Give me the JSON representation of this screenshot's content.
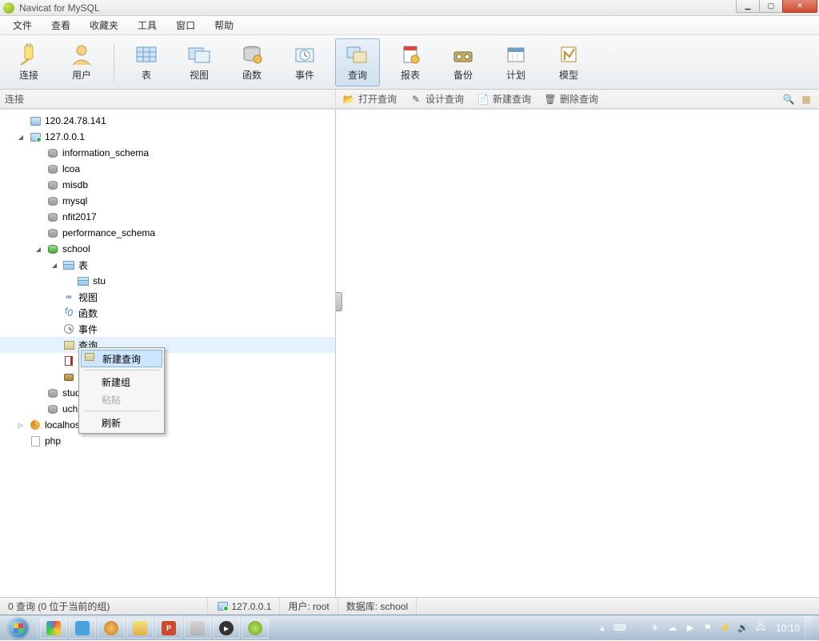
{
  "window": {
    "title": "Navicat for MySQL"
  },
  "menu": {
    "items": [
      "文件",
      "查看",
      "收藏夹",
      "工具",
      "窗口",
      "帮助"
    ]
  },
  "toolbar": {
    "groups": [
      {
        "items": [
          {
            "name": "connect",
            "label": "连接"
          },
          {
            "name": "user",
            "label": "用户"
          }
        ]
      },
      {
        "items": [
          {
            "name": "table",
            "label": "表"
          },
          {
            "name": "view",
            "label": "视图"
          },
          {
            "name": "function",
            "label": "函数"
          },
          {
            "name": "event",
            "label": "事件"
          },
          {
            "name": "query",
            "label": "查询",
            "active": true
          },
          {
            "name": "report",
            "label": "报表"
          },
          {
            "name": "backup",
            "label": "备份"
          },
          {
            "name": "schedule",
            "label": "计划"
          },
          {
            "name": "model",
            "label": "模型"
          }
        ]
      }
    ]
  },
  "sub_header": {
    "left_title": "连接",
    "actions": [
      {
        "name": "open-query",
        "label": "打开查询"
      },
      {
        "name": "design-query",
        "label": "设计查询"
      },
      {
        "name": "new-query",
        "label": "新建查询"
      },
      {
        "name": "delete-query",
        "label": "删除查询"
      }
    ]
  },
  "tree": {
    "nodes": [
      {
        "icon": "server",
        "label": "120.24.78.141",
        "depth": 1
      },
      {
        "icon": "server-on",
        "label": "127.0.0.1",
        "depth": 1,
        "arrow": "open"
      },
      {
        "icon": "db",
        "label": "information_schema",
        "depth": 2
      },
      {
        "icon": "db",
        "label": "lcoa",
        "depth": 2
      },
      {
        "icon": "db",
        "label": "misdb",
        "depth": 2
      },
      {
        "icon": "db",
        "label": "mysql",
        "depth": 2
      },
      {
        "icon": "db",
        "label": "nfit2017",
        "depth": 2
      },
      {
        "icon": "db",
        "label": "performance_schema",
        "depth": 2
      },
      {
        "icon": "db-active",
        "label": "school",
        "depth": 2,
        "arrow": "open"
      },
      {
        "icon": "folder-table",
        "label": "表",
        "depth": 3,
        "arrow": "open"
      },
      {
        "icon": "table",
        "label": "stu",
        "depth": 4
      },
      {
        "icon": "view",
        "label": "视图",
        "depth": 3
      },
      {
        "icon": "fn",
        "label": "函数",
        "depth": 3
      },
      {
        "icon": "event",
        "label": "事件",
        "depth": 3
      },
      {
        "icon": "query",
        "label": "查询",
        "depth": 3,
        "selected": true
      },
      {
        "icon": "report",
        "label": "报",
        "depth": 3
      },
      {
        "icon": "backup",
        "label": "备",
        "depth": 3
      },
      {
        "icon": "db",
        "label": "stude",
        "depth": 2
      },
      {
        "icon": "db",
        "label": "uchr_",
        "depth": 2
      },
      {
        "icon": "localhost",
        "label": "localhost",
        "depth": 1,
        "arrow": "closed"
      },
      {
        "icon": "file",
        "label": "php",
        "depth": 1
      }
    ]
  },
  "context_menu": {
    "items": [
      {
        "name": "new-query",
        "label": "新建查询",
        "highlight": true,
        "icon": true
      },
      {
        "sep": true
      },
      {
        "name": "new-group",
        "label": "新建组"
      },
      {
        "name": "paste",
        "label": "粘贴",
        "disabled": true
      },
      {
        "sep": true
      },
      {
        "name": "refresh",
        "label": "刷新"
      }
    ]
  },
  "status": {
    "left": "0 查询 (0 位于当前的组)",
    "conn": "127.0.0.1",
    "user_label": "用户: root",
    "db_label": "数据库: school"
  },
  "taskbar": {
    "clock": "10:10"
  }
}
